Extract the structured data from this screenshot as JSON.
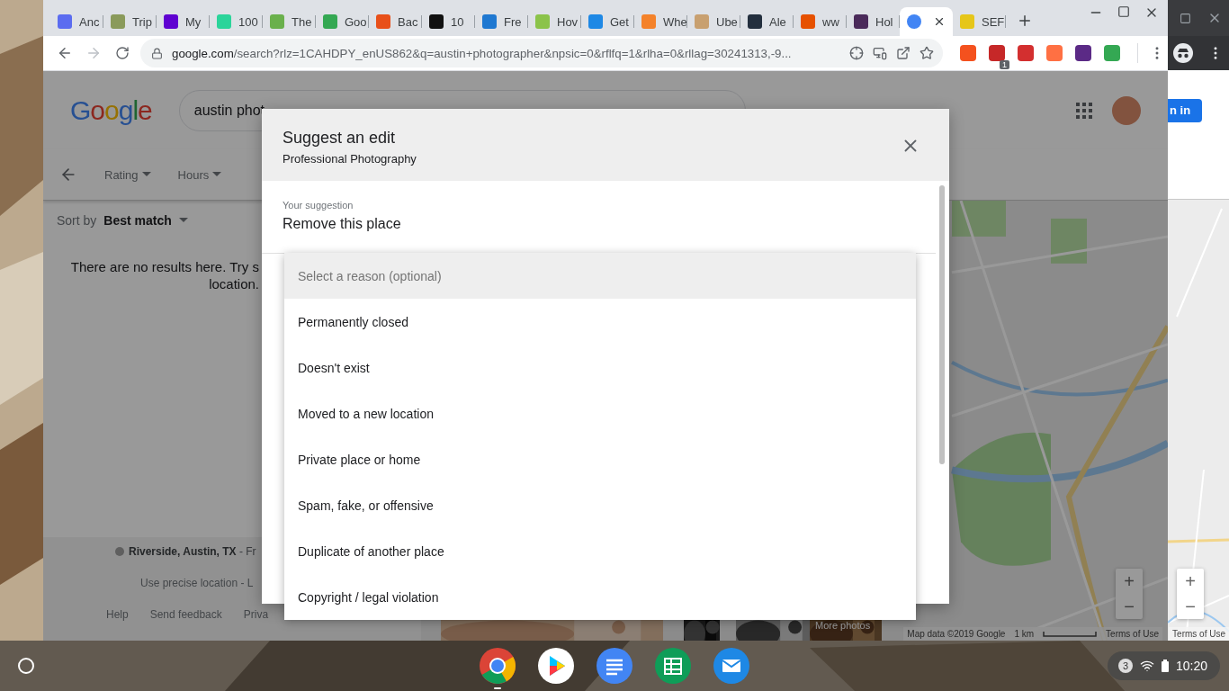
{
  "browser": {
    "tabs": [
      {
        "title": "Anc",
        "color": "#5b6cf0",
        "selected": false
      },
      {
        "title": "Trip",
        "color": "#8a9a5b",
        "selected": false
      },
      {
        "title": "My",
        "color": "#5f01d1",
        "selected": false
      },
      {
        "title": "100",
        "color": "#2bd49a",
        "selected": false
      },
      {
        "title": "The",
        "color": "#6ab04c",
        "selected": false
      },
      {
        "title": "Goo",
        "color": "#34a853",
        "selected": false
      },
      {
        "title": "Bac",
        "color": "#e8501a",
        "selected": false
      },
      {
        "title": "10",
        "color": "#111111",
        "selected": false
      },
      {
        "title": "Fre",
        "color": "#1f78d1",
        "selected": false
      },
      {
        "title": "Hov",
        "color": "#8bc34a",
        "selected": false
      },
      {
        "title": "Get",
        "color": "#1e88e5",
        "selected": false
      },
      {
        "title": "Whe",
        "color": "#f4822a",
        "selected": false
      },
      {
        "title": "Ube",
        "color": "#c8a070",
        "selected": false
      },
      {
        "title": "Ale",
        "color": "#232f3e",
        "selected": false
      },
      {
        "title": "ww",
        "color": "#e65100",
        "selected": false
      },
      {
        "title": "Hol",
        "color": "#4a2a5a",
        "selected": false
      },
      {
        "color": "#4285f4",
        "selected": true
      },
      {
        "title": "SEF",
        "color": "#e6c619",
        "selected": false
      }
    ],
    "address": {
      "host": "google.com",
      "path": "/search?rlz=1CAHDPY_enUS862&q=austin+photographer&npsic=0&rflfq=1&rlha=0&rllag=30241313,-9..."
    },
    "extensions": [
      {
        "color": "#f4511e"
      },
      {
        "color": "#c62828",
        "badge": "1"
      },
      {
        "color": "#d32f2f"
      },
      {
        "color": "#ff7043"
      },
      {
        "color": "#5b2a86"
      },
      {
        "color": "#34a853"
      }
    ]
  },
  "page": {
    "logo": "Google",
    "search": {
      "value": "austin phot"
    },
    "filters": [
      "Rating",
      "Hours"
    ],
    "sort": {
      "label": "Sort by",
      "value": "Best match"
    },
    "message": "There are no results here. Try s\nlocation.",
    "location": "**Riverside, Austin, TX** - Fr",
    "precise_location": "Use precise location - L",
    "footer_links": [
      "Help",
      "Send feedback",
      "Priva"
    ],
    "map": {
      "attribution": "Map data ©2019 Google",
      "scale": "1 km",
      "terms": "Terms of Use",
      "zoom_in": "+",
      "zoom_out": "−"
    },
    "photos": {
      "more": "More photos"
    }
  },
  "dialog": {
    "title": "Suggest an edit",
    "subtitle": "Professional Photography",
    "suggestion_label": "Your suggestion",
    "suggestion": "Remove this place",
    "reasons": [
      {
        "label": "Select a reason (optional)",
        "kind": "placeholder",
        "selected": true
      },
      {
        "label": "Permanently closed",
        "kind": "option",
        "selected": false
      },
      {
        "label": "Doesn't exist",
        "kind": "option",
        "selected": false
      },
      {
        "label": "Moved to a new location",
        "kind": "option",
        "selected": false
      },
      {
        "label": "Private place or home",
        "kind": "option",
        "selected": false
      },
      {
        "label": "Spam, fake, or offensive",
        "kind": "option",
        "selected": false
      },
      {
        "label": "Duplicate of another place",
        "kind": "option",
        "selected": false
      },
      {
        "label": "Copyright / legal violation",
        "kind": "option",
        "selected": false
      }
    ]
  },
  "side_window": {
    "button": "n in",
    "terms": "Terms of Use",
    "zoom_in": "+",
    "zoom_out": "−"
  },
  "shelf": {
    "apps": [
      {
        "kind": "chrome",
        "running": true
      },
      {
        "kind": "play",
        "running": false
      },
      {
        "kind": "docs",
        "running": false
      },
      {
        "kind": "sheets",
        "running": false
      },
      {
        "kind": "mail",
        "running": false
      }
    ],
    "notifications": "3",
    "time": "10:20"
  }
}
